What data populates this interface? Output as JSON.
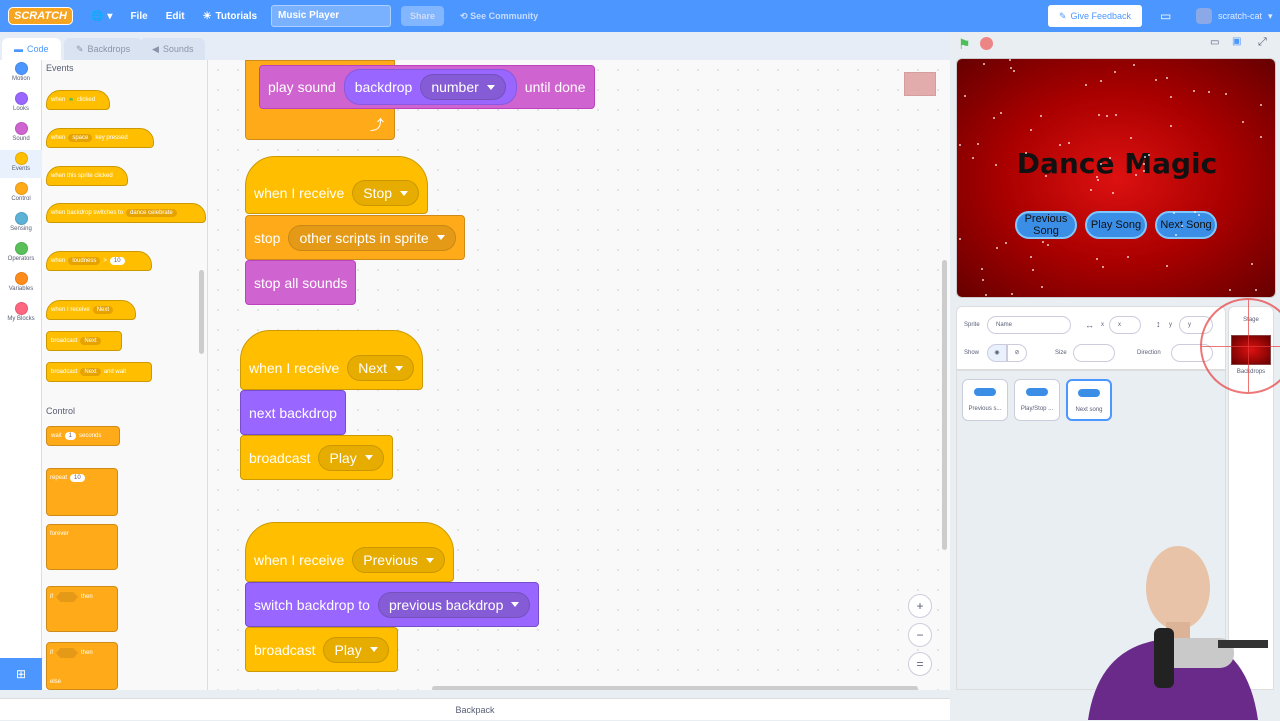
{
  "menubar": {
    "logo": "SCRATCH",
    "globe_icon": "globe-icon",
    "file": "File",
    "edit": "Edit",
    "tutorials": "Tutorials",
    "project_title": "Music Player",
    "share": "Share",
    "see_community": "See Community",
    "give_feedback": "Give Feedback",
    "username": "scratch-cat"
  },
  "tabs": {
    "code": "Code",
    "backdrops": "Backdrops",
    "sounds": "Sounds"
  },
  "categories": [
    {
      "label": "Motion",
      "color": "#4c97ff"
    },
    {
      "label": "Looks",
      "color": "#9966ff"
    },
    {
      "label": "Sound",
      "color": "#cf63cf"
    },
    {
      "label": "Events",
      "color": "#ffbf00"
    },
    {
      "label": "Control",
      "color": "#ffab19"
    },
    {
      "label": "Sensing",
      "color": "#5cb1d6"
    },
    {
      "label": "Operators",
      "color": "#59c059"
    },
    {
      "label": "Variables",
      "color": "#ff8c1a"
    },
    {
      "label": "My Blocks",
      "color": "#ff6680"
    }
  ],
  "palette": {
    "events_heading": "Events",
    "control_heading": "Control",
    "when_flag": "when",
    "when_flag_tail": "clicked",
    "when_key": "when",
    "key_value": "space",
    "key_tail": "key pressed",
    "when_sprite_clicked": "when this sprite clicked",
    "when_backdrop": "when backdrop switches to",
    "backdrop_value": "dance celebrate",
    "when_loudness": "when",
    "loudness_value": "loudness",
    "gt": ">",
    "loudness_num": "10",
    "when_receive": "when I receive",
    "receive_value": "Next",
    "broadcast": "broadcast",
    "broadcast_value": "Next",
    "broadcast_wait": "broadcast",
    "broadcast_wait_value": "Next",
    "broadcast_wait_tail": "and wait",
    "wait": "wait",
    "wait_num": "1",
    "wait_tail": "seconds",
    "repeat": "repeat",
    "repeat_num": "10",
    "forever": "forever",
    "if1": "if",
    "then1": "then",
    "if2": "if",
    "then2": "then",
    "else": "else"
  },
  "script": {
    "play_sound": "play sound",
    "play_sound_arg1": "backdrop",
    "play_sound_arg2": "number",
    "until_done": "until done",
    "recv_stop": "when I receive",
    "recv_stop_val": "Stop",
    "stop": "stop",
    "stop_val": "other scripts in sprite",
    "stop_all_sounds": "stop all sounds",
    "recv_next": "when I receive",
    "recv_next_val": "Next",
    "next_backdrop": "next backdrop",
    "broadcast1": "broadcast",
    "broadcast1_val": "Play",
    "recv_prev": "when I receive",
    "recv_prev_val": "Previous",
    "switch_backdrop": "switch backdrop to",
    "switch_backdrop_val": "previous backdrop",
    "broadcast2": "broadcast",
    "broadcast2_val": "Play"
  },
  "zoom": {
    "in": "+",
    "out": "−",
    "reset": "="
  },
  "backpack": "Backpack",
  "stage": {
    "title": "Dance Magic",
    "prev": "Previous Song",
    "play": "Play Song",
    "next": "Next Song"
  },
  "sprite_info": {
    "sprite_label": "Sprite",
    "name_placeholder": "Name",
    "x_label": "x",
    "x_placeholder": "x",
    "y_label": "y",
    "y_placeholder": "y",
    "show_label": "Show",
    "size_label": "Size",
    "direction_label": "Direction"
  },
  "sprites": [
    {
      "name": "Previous s..."
    },
    {
      "name": "Play/Stop ..."
    },
    {
      "name": "Next song"
    }
  ],
  "stage_pane": {
    "label": "Stage",
    "backdrops": "Backdrops"
  }
}
